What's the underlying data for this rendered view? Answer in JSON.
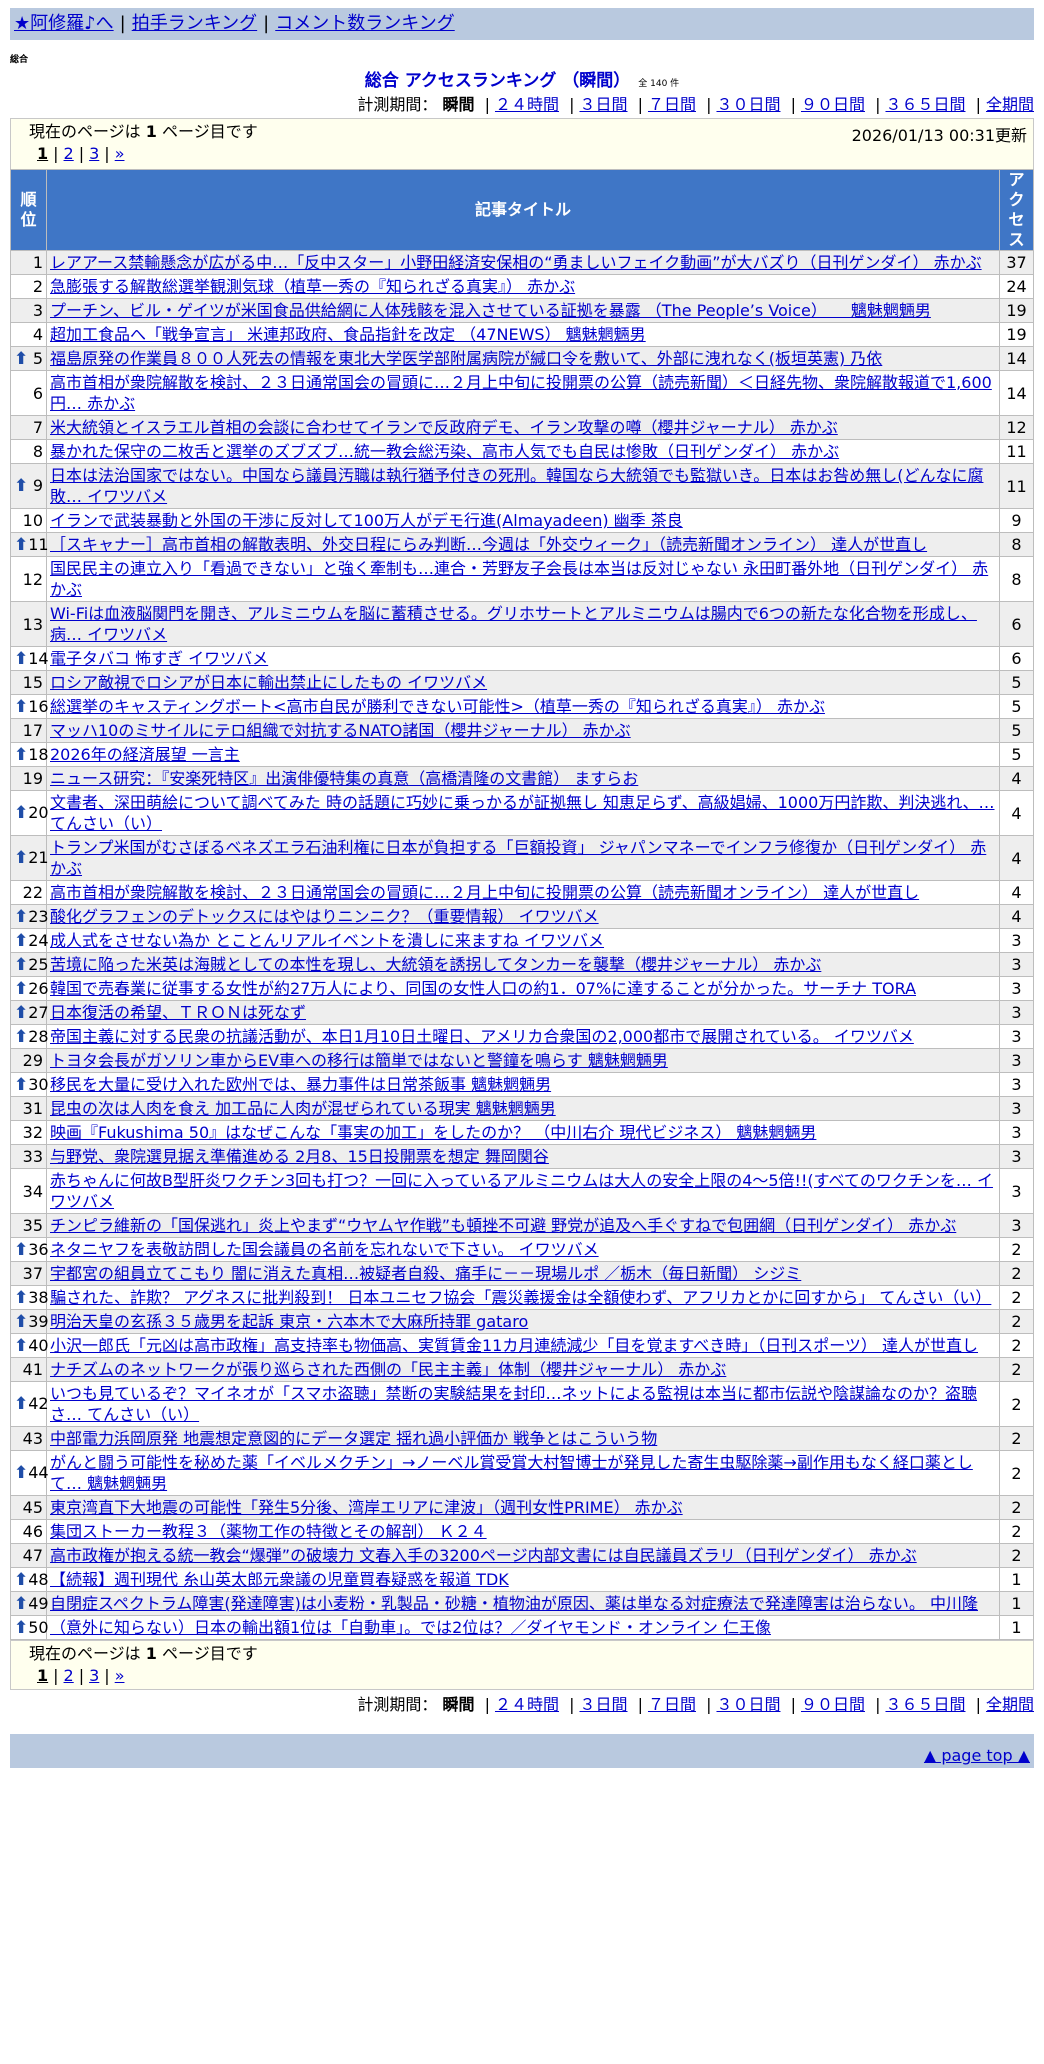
{
  "nav": {
    "links": [
      "★阿修羅♪へ",
      "拍手ランキング",
      "コメント数ランキング"
    ]
  },
  "category": "総合",
  "heading": {
    "title": "総合 アクセスランキング （瞬間）",
    "count": "全 140 件"
  },
  "period": {
    "label": "計測期間：",
    "current": "瞬間",
    "options": [
      "２４時間",
      "３日間",
      "７日間",
      "３０日間",
      "９０日間",
      "３６５日間",
      "全期間"
    ]
  },
  "pager": {
    "status_prefix": "現在のページは ",
    "status_page": "1",
    "status_suffix": " ページ目です",
    "current": "1",
    "pages": [
      "2",
      "3"
    ],
    "next": "»"
  },
  "updated": "2026/01/13 00:31更新",
  "columns": {
    "rank": "順位",
    "title": "記事タイトル",
    "access": "アクセス"
  },
  "rows": [
    {
      "rank": "1",
      "up": false,
      "title": "レアアース禁輸懸念が広がる中…「反中スター」小野田経済安保相の“勇ましいフェイク動画”が大バズり（日刊ゲンダイ） 赤かぶ",
      "access": "37"
    },
    {
      "rank": "2",
      "up": false,
      "title": "急膨張する解散総選挙観測気球（植草一秀の『知られざる真実』） 赤かぶ",
      "access": "24"
    },
    {
      "rank": "3",
      "up": false,
      "title": "プーチン、ビル・ゲイツが米国食品供給網に人体残骸を混入させている証拠を暴露 （The People’s Voice）　　魑魅魍魎男",
      "access": "19"
    },
    {
      "rank": "4",
      "up": false,
      "title": "超加工食品へ「戦争宣言」 米連邦政府、食品指針を改定 （47NEWS） 魑魅魍魎男",
      "access": "19"
    },
    {
      "rank": "5",
      "up": true,
      "title": "福島原発の作業員８００人死去の情報を東北大学医学部附属病院が緘口令を敷いて、外部に洩れなく(板垣英憲) 乃依",
      "access": "14"
    },
    {
      "rank": "6",
      "up": false,
      "title": "高市首相が衆院解散を検討、２３日通常国会の冒頭に…２月上中旬に投開票の公算（読売新聞）＜日経先物、衆院解散報道で1,600円… 赤かぶ",
      "access": "14"
    },
    {
      "rank": "7",
      "up": false,
      "title": "米大統領とイスラエル首相の会談に合わせてイランで反政府デモ、イラン攻撃の噂（櫻井ジャーナル） 赤かぶ",
      "access": "12"
    },
    {
      "rank": "8",
      "up": false,
      "title": "暴かれた保守の二枚舌と選挙のズブズブ…統一教会総汚染、高市人気でも自民は惨敗（日刊ゲンダイ） 赤かぶ",
      "access": "11"
    },
    {
      "rank": "9",
      "up": true,
      "title": "日本は法治国家ではない。中国なら議員汚職は執行猶予付きの死刑。韓国なら大統領でも監獄いき。日本はお咎め無し(どんなに腐敗… イワツバメ",
      "access": "11"
    },
    {
      "rank": "10",
      "up": false,
      "title": "イランで武装暴動と外国の干渉に反対して100万人がデモ行進(Almayadeen) 幽季 茶良",
      "access": "9"
    },
    {
      "rank": "11",
      "up": true,
      "title": "［スキャナー］高市首相の解散表明、外交日程にらみ判断…今週は「外交ウィーク」（読売新聞オンライン） 達人が世直し",
      "access": "8"
    },
    {
      "rank": "12",
      "up": false,
      "title": "国民民主の連立入り「看過できない」と強く牽制も…連合・芳野友子会長は本当は反対じゃない 永田町番外地（日刊ゲンダイ） 赤かぶ",
      "access": "8"
    },
    {
      "rank": "13",
      "up": false,
      "title": "Wi-Fiは血液脳関門を開き、アルミニウムを脳に蓄積させる。グリホサートとアルミニウムは腸内で6つの新たな化合物を形成し、病… イワツバメ",
      "access": "6"
    },
    {
      "rank": "14",
      "up": true,
      "title": "電子タバコ 怖すぎ イワツバメ",
      "access": "6"
    },
    {
      "rank": "15",
      "up": false,
      "title": "ロシア敵視でロシアが日本に輸出禁止にしたもの イワツバメ",
      "access": "5"
    },
    {
      "rank": "16",
      "up": true,
      "title": "総選挙のキャスティングボート<高市自民が勝利できない可能性>（植草一秀の『知られざる真実』） 赤かぶ",
      "access": "5"
    },
    {
      "rank": "17",
      "up": false,
      "title": "マッハ10のミサイルにテロ組織で対抗するNATO諸国（櫻井ジャーナル） 赤かぶ",
      "access": "5"
    },
    {
      "rank": "18",
      "up": true,
      "title": "2026年の経済展望 一言主",
      "access": "5"
    },
    {
      "rank": "19",
      "up": false,
      "title": "ニュース研究：『安楽死特区』出演俳優特集の真意（高橋清隆の文書館） ますらお",
      "access": "4"
    },
    {
      "rank": "20",
      "up": true,
      "title": "文書者、深田萌絵について調べてみた 時の話題に巧妙に乗っかるが証拠無し 知恵足らず、高級娼婦、1000万円詐欺、判決逃れ、… てんさい（い）",
      "access": "4"
    },
    {
      "rank": "21",
      "up": true,
      "title": "トランプ米国がむさぼるベネズエラ石油利権に日本が負担する「巨額投資」 ジャパンマネーでインフラ修復か（日刊ゲンダイ） 赤かぶ",
      "access": "4"
    },
    {
      "rank": "22",
      "up": false,
      "title": "高市首相が衆院解散を検討、２３日通常国会の冒頭に…２月上中旬に投開票の公算（読売新聞オンライン） 達人が世直し",
      "access": "4"
    },
    {
      "rank": "23",
      "up": true,
      "title": "酸化グラフェンのデトックスにはやはりニンニク？（重要情報） イワツバメ",
      "access": "4"
    },
    {
      "rank": "24",
      "up": true,
      "title": "成人式をさせない為か とことんリアルイベントを潰しに来ますね イワツバメ",
      "access": "3"
    },
    {
      "rank": "25",
      "up": true,
      "title": "苦境に陥った米英は海賊としての本性を現し、大統領を誘拐してタンカーを襲撃（櫻井ジャーナル） 赤かぶ",
      "access": "3"
    },
    {
      "rank": "26",
      "up": true,
      "title": "韓国で売春業に従事する女性が約27万人により、同国の女性人口の約1．07%に達することが分かった。サーチナ TORA",
      "access": "3"
    },
    {
      "rank": "27",
      "up": true,
      "title": "日本復活の希望、ＴＲＯＮは死なず",
      "access": "3"
    },
    {
      "rank": "28",
      "up": true,
      "title": "帝国主義に対する民衆の抗議活動が、本日1月10日土曜日、アメリカ合衆国の2,000都市で展開されている。 イワツバメ",
      "access": "3"
    },
    {
      "rank": "29",
      "up": false,
      "title": "トヨタ会長がガソリン車からEV車への移行は簡単ではないと警鐘を鳴らす 魑魅魍魎男",
      "access": "3"
    },
    {
      "rank": "30",
      "up": true,
      "title": "移民を大量に受け入れた欧州では、暴力事件は日常茶飯事 魑魅魍魎男",
      "access": "3"
    },
    {
      "rank": "31",
      "up": false,
      "title": "昆虫の次は人肉を食え 加工品に人肉が混ぜられている現実 魑魅魍魎男",
      "access": "3"
    },
    {
      "rank": "32",
      "up": false,
      "title": "映画『Fukushima 50』はなぜこんな「事実の加工」をしたのか？ （中川右介 現代ビジネス） 魑魅魍魎男",
      "access": "3"
    },
    {
      "rank": "33",
      "up": false,
      "title": "与野党、衆院選見据え準備進める 2月8、15日投開票を想定 舞岡関谷",
      "access": "3"
    },
    {
      "rank": "34",
      "up": false,
      "title": "赤ちゃんに何故B型肝炎ワクチン3回も打つ？一回に入っているアルミニウムは大人の安全上限の4～5倍!!(すべてのワクチンを… イワツバメ",
      "access": "3"
    },
    {
      "rank": "35",
      "up": false,
      "title": "チンピラ維新の「国保逃れ」炎上やまず“ウヤムヤ作戦”も頓挫不可避 野党が追及へ手ぐすねで包囲網（日刊ゲンダイ） 赤かぶ",
      "access": "3"
    },
    {
      "rank": "36",
      "up": true,
      "title": "ネタニヤフを表敬訪問した国会議員の名前を忘れないで下さい。 イワツバメ",
      "access": "2"
    },
    {
      "rank": "37",
      "up": false,
      "title": "宇都宮の組員立てこもり 闇に消えた真相…被疑者自殺、痛手に－－現場ルポ ／栃木（毎日新聞） シジミ",
      "access": "2"
    },
    {
      "rank": "38",
      "up": true,
      "title": "騙された、詐欺？ アグネスに批判殺到！ 日本ユニセフ協会「震災義援金は全額使わず、アフリカとかに回すから」 てんさい（い）",
      "access": "2"
    },
    {
      "rank": "39",
      "up": true,
      "title": "明治天皇の玄孫３５歳男を起訴 東京・六本木で大麻所持罪 gataro",
      "access": "2"
    },
    {
      "rank": "40",
      "up": true,
      "title": "小沢一郎氏「元凶は高市政権」高支持率も物価高、実質賃金11カ月連続減少「目を覚ますべき時」（日刊スポーツ） 達人が世直し",
      "access": "2"
    },
    {
      "rank": "41",
      "up": false,
      "title": "ナチズムのネットワークが張り巡らされた西側の「民主主義」体制（櫻井ジャーナル） 赤かぶ",
      "access": "2"
    },
    {
      "rank": "42",
      "up": true,
      "title": "いつも見ているぞ？マイネオが「スマホ盗聴」禁断の実験結果を封印…ネットによる監視は本当に都市伝説や陰謀論なのか？盗聴さ… てんさい（い）",
      "access": "2"
    },
    {
      "rank": "43",
      "up": false,
      "title": "中部電力浜岡原発 地震想定意図的にデータ選定 揺れ過小評価か 戦争とはこういう物",
      "access": "2"
    },
    {
      "rank": "44",
      "up": true,
      "title": "がんと闘う可能性を秘めた薬「イベルメクチン」→ノーベル賞受賞大村智博士が発見した寄生虫駆除薬→副作用もなく経口薬として… 魑魅魍魎男",
      "access": "2"
    },
    {
      "rank": "45",
      "up": false,
      "title": "東京湾直下大地震の可能性「発生5分後、湾岸エリアに津波」（週刊女性PRIME） 赤かぶ",
      "access": "2"
    },
    {
      "rank": "46",
      "up": false,
      "title": "集団ストーカー教程３（薬物工作の特徴とその解剖） Ｋ２４",
      "access": "2"
    },
    {
      "rank": "47",
      "up": false,
      "title": "高市政権が抱える統一教会“爆弾”の破壊力 文春入手の3200ページ内部文書には自民議員ズラリ（日刊ゲンダイ） 赤かぶ",
      "access": "2"
    },
    {
      "rank": "48",
      "up": true,
      "title": "【続報】週刊現代 糸山英太郎元衆議の児童買春疑惑を報道 TDK",
      "access": "1"
    },
    {
      "rank": "49",
      "up": true,
      "title": "自閉症スペクトラム障害(発達障害)は小麦粉・乳製品・砂糖・植物油が原因、薬は単なる対症療法で発達障害は治らない。 中川隆",
      "access": "1"
    },
    {
      "rank": "50",
      "up": true,
      "title": "（意外に知らない）日本の輸出額1位は「自動車」。では2位は？／ダイヤモンド・オンライン 仁王像",
      "access": "1"
    }
  ],
  "footer": {
    "page_top": "▲ page top ▲"
  },
  "colors": {
    "header_blue": "#3f76c6",
    "bar": "#b9c9df",
    "link": "#0000cc",
    "up_arrow": "#1f4da8"
  }
}
